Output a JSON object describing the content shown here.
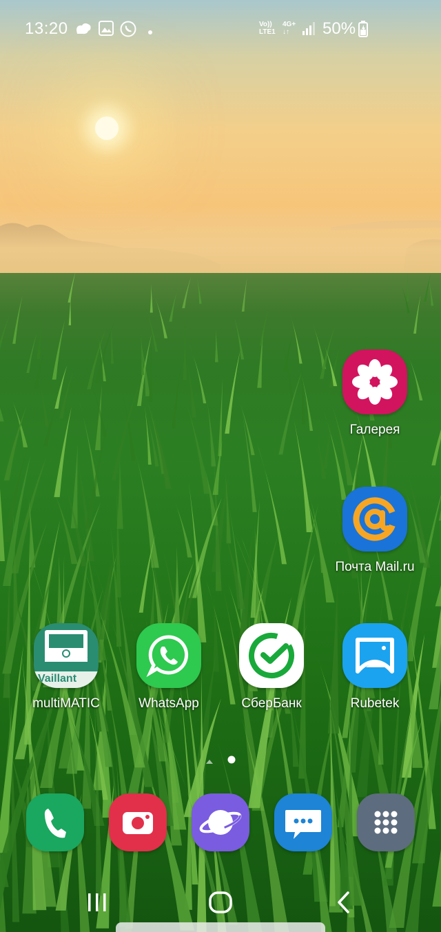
{
  "status_bar": {
    "time": "13:20",
    "notification_icons": [
      "weather-icon",
      "gallery-notification-icon",
      "call-notification-icon",
      "more-dot-icon"
    ],
    "network": {
      "volte": "Vo))",
      "lte": "LTE1",
      "type": "4G+"
    },
    "battery": "50%"
  },
  "home_apps": [
    {
      "id": "gallery",
      "label": "Галерея"
    },
    {
      "id": "mail",
      "label": "Почта Mail.ru"
    },
    {
      "id": "multimatic",
      "label": "multiMATIC"
    },
    {
      "id": "whatsapp",
      "label": "WhatsApp"
    },
    {
      "id": "sberbank",
      "label": "СберБанк"
    },
    {
      "id": "rubetek",
      "label": "Rubetek"
    }
  ],
  "multimatic_logo_text": "Vaillant",
  "page_indicator": {
    "pages": 2,
    "current": 2
  },
  "dock": [
    {
      "id": "phone",
      "icon": "phone-icon"
    },
    {
      "id": "camera",
      "icon": "camera-icon"
    },
    {
      "id": "internet",
      "icon": "planet-icon"
    },
    {
      "id": "messages",
      "icon": "message-icon"
    },
    {
      "id": "apps",
      "icon": "apps-grid-icon"
    }
  ],
  "nav_bar": [
    "recent-apps-icon",
    "home-icon",
    "back-icon"
  ],
  "colors": {
    "gallery": "#d2145f",
    "mail": "#1a73d9",
    "mail_accent": "#f6a623",
    "multimatic": "#2a8d72",
    "whatsapp": "#2ec94f",
    "sberbank": "#ffffff",
    "sber_green": "#19a93a",
    "rubetek": "#1ba3ef",
    "phone": "#1aa760",
    "camera": "#e2304a",
    "internet": "#7a5ce0",
    "messages": "#1d84d6",
    "apps": "#5d6c7e"
  }
}
